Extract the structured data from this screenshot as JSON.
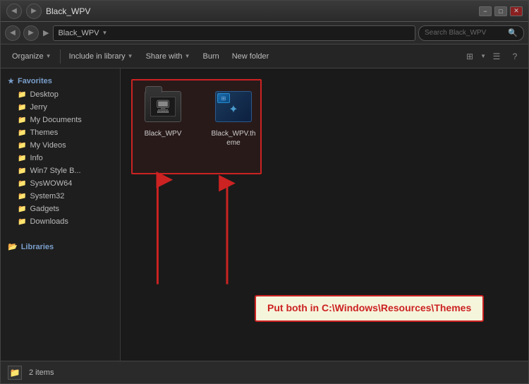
{
  "window": {
    "title": "Black_WPV",
    "min_btn": "−",
    "max_btn": "□",
    "close_btn": "✕"
  },
  "address_bar": {
    "back": "◀",
    "forward": "▶",
    "path": "Black_WPV",
    "path_separator": "▶",
    "root": "▶",
    "search_placeholder": "Search Black_WPV",
    "search_icon": "🔍"
  },
  "toolbar": {
    "organize": "Organize",
    "include_in_library": "Include in library",
    "share_with": "Share with",
    "burn": "Burn",
    "new_folder": "New folder",
    "dropdown_arrow": "▼"
  },
  "sidebar": {
    "favorites_label": "Favorites",
    "favorites_icon": "★",
    "items": [
      {
        "label": "Desktop",
        "type": "folder"
      },
      {
        "label": "Jerry",
        "type": "folder"
      },
      {
        "label": "My Documents",
        "type": "folder"
      },
      {
        "label": "Themes",
        "type": "folder"
      },
      {
        "label": "My Videos",
        "type": "folder"
      },
      {
        "label": "Info",
        "type": "folder"
      },
      {
        "label": "Win7 Style B...",
        "type": "folder"
      },
      {
        "label": "SysWOW64",
        "type": "folder"
      },
      {
        "label": "System32",
        "type": "folder"
      },
      {
        "label": "Gadgets",
        "type": "folder"
      },
      {
        "label": "Downloads",
        "type": "folder"
      }
    ],
    "libraries_label": "Libraries"
  },
  "files": [
    {
      "name": "Black_WPV",
      "type": "folder",
      "icon": "folder"
    },
    {
      "name": "Black_WPV.theme",
      "type": "theme",
      "icon": "theme"
    }
  ],
  "instruction": {
    "text": "Put both in C:\\Windows\\Resources\\Themes"
  },
  "status_bar": {
    "count": "2 items"
  }
}
